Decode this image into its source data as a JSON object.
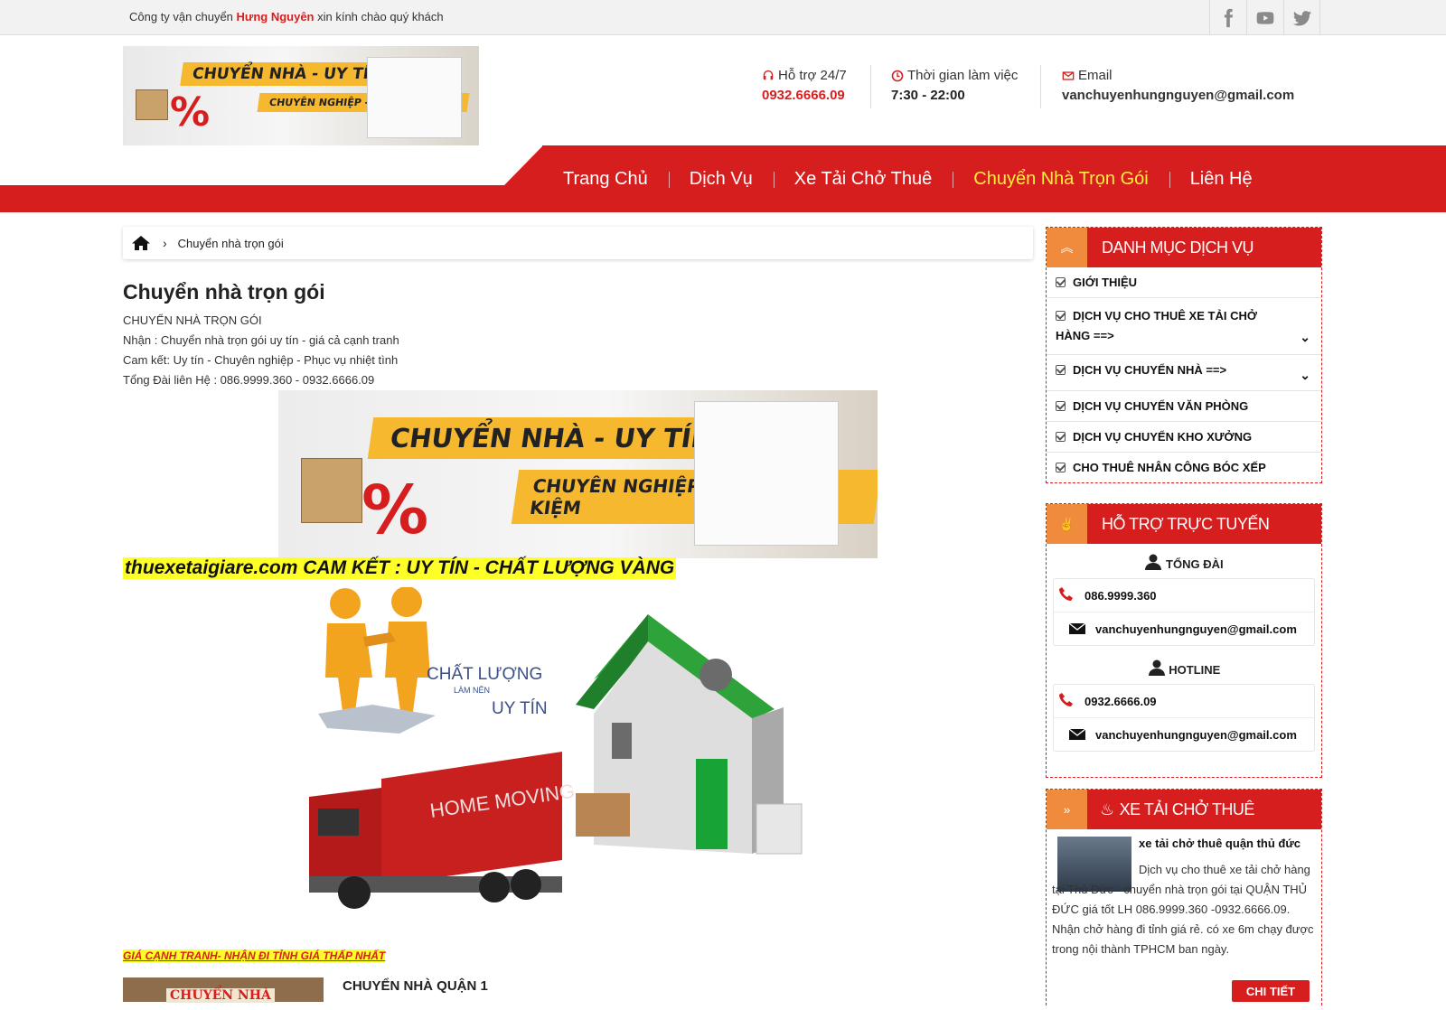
{
  "topbar": {
    "greet_prefix": "Công ty vận chuyển ",
    "greet_brand": "Hưng Nguyên",
    "greet_suffix": " xin kính chào quý khách",
    "social": [
      "facebook-icon",
      "youtube-icon",
      "twitter-icon"
    ]
  },
  "logo": {
    "line1": "CHUYỂN NHÀ - UY TÍN",
    "line2": "CHUYÊN NGHIỆP - SIÊU TIẾT KIỆM",
    "percent": "%"
  },
  "header": {
    "support_label": "Hỗ trợ 24/7",
    "support_value": "0932.6666.09",
    "hours_label": "Thời gian làm việc",
    "hours_value": "7:30 - 22:00",
    "email_label": "Email",
    "email_value": "vanchuyenhungnguyen@gmail.com"
  },
  "nav": {
    "items": [
      "Trang Chủ",
      "Dịch Vụ",
      "Xe Tải Chở Thuê",
      "Chuyển Nhà Trọn Gói",
      "Liên Hệ"
    ],
    "active": "Chuyển Nhà Trọn Gói"
  },
  "breadcrumb": {
    "current": "Chuyển nhà trọn gói"
  },
  "content": {
    "title": "Chuyển nhà trọn gói",
    "lines": [
      "CHUYỂN NHÀ TRỌN GÓI",
      "Nhận : Chuyển nhà trọn gói uy tín - giá cả cạnh tranh",
      "Cam kết: Uy tín - Chuyên nghiệp - Phục vụ nhiệt tình",
      "Tổng Đài liên Hệ : 086.9999.360 - 0932.6666.09"
    ],
    "banner_line1": "CHUYỂN NHÀ - UY TÍN",
    "banner_line2": "CHUYÊN NGHIỆP - SIÊU TIẾT KIỆM",
    "commit": "thuexetaigiare.com  CAM KẾT : UY TÍN - CHẤT LƯỢNG VÀNG",
    "house_text1": "CHẤT LƯỢNG",
    "house_text2": "LÀM NÊN",
    "house_text3": "UY TÍN",
    "truck_text": "HOME MOVING",
    "price": "GIÁ CẠNH TRANH- NHẬN ĐI TỈNH GIÁ THẤP NHẤT",
    "thumb_label": "CHUYỂN NHÀ",
    "subhead": "CHUYỂN NHÀ QUẬN 1"
  },
  "sidebar": {
    "categories_title": "DANH MỤC DỊCH VỤ",
    "categories": [
      {
        "label": "GIỚI THIỆU",
        "expandable": false
      },
      {
        "label": "DỊCH VỤ CHO THUÊ XE TẢI CHỞ HÀNG ==>",
        "expandable": true
      },
      {
        "label": "DỊCH VỤ CHUYỂN NHÀ ==>",
        "expandable": true
      },
      {
        "label": "DỊCH VỤ CHUYỂN VĂN PHÒNG",
        "expandable": false
      },
      {
        "label": "DỊCH VỤ CHUYỂN KHO XƯỞNG",
        "expandable": false
      },
      {
        "label": "CHO THUÊ NHÂN CÔNG BÓC XẾP",
        "expandable": false
      }
    ],
    "support_title": "HỖ TRỢ TRỰC TUYẾN",
    "support": [
      {
        "name": "TỔNG ĐÀI",
        "phone": "086.9999.360",
        "email": "vanchuyenhungnguyen@gmail.com"
      },
      {
        "name": "HOTLINE",
        "phone": "0932.6666.09",
        "email": "vanchuyenhungnguyen@gmail.com"
      }
    ],
    "trucks_title": "XE TẢI CHỞ THUÊ",
    "truck_item": {
      "title": "xe tải chở thuê quận thủ đức",
      "desc": "Dịch vụ cho thuê xe tải chở hàng tại Thủ Đức - chuyển nhà trọn gói tại QUẬN THỦ ĐỨC giá tốt LH 086.9999.360 -0932.6666.09. Nhận chở hàng đi tỉnh giá rẻ. có xe 6m chạy được trong nội thành TPHCM ban ngày.",
      "button": "CHI TIẾT"
    }
  },
  "colors": {
    "brand_red": "#d71e1e",
    "accent_orange": "#f08a3c",
    "highlight_yellow": "#ffff28",
    "active_nav": "#ffef3a"
  }
}
